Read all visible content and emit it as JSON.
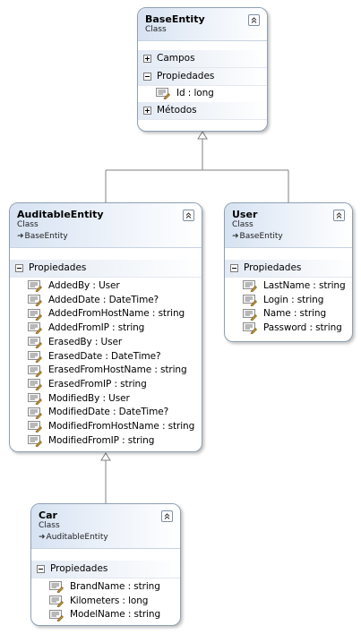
{
  "icons": {
    "collapse": "double-chevron-up-icon",
    "property": "property-icon",
    "inherits": "inheritance-arrow-icon"
  },
  "colors": {
    "border": "#8fa0b3",
    "header_grad": "#d6e2f2",
    "connector": "#808080"
  },
  "classes": {
    "base_entity": {
      "title": "BaseEntity",
      "kind": "Class",
      "sections": [
        {
          "label": "Campos",
          "state": "collapsed"
        },
        {
          "label": "Propiedades",
          "state": "expanded"
        },
        {
          "label": "Métodos",
          "state": "collapsed"
        }
      ],
      "properties": [
        "Id : long"
      ]
    },
    "auditable_entity": {
      "title": "AuditableEntity",
      "kind": "Class",
      "inherits": "BaseEntity",
      "section_label": "Propiedades",
      "properties": [
        "AddedBy : User",
        "AddedDate : DateTime?",
        "AddedFromHostName : string",
        "AddedFromIP : string",
        "ErasedBy : User",
        "ErasedDate : DateTime?",
        "ErasedFromHostName : string",
        "ErasedFromIP : string",
        "ModifiedBy : User",
        "ModifiedDate : DateTime?",
        "ModifiedFromHostName : string",
        "ModifiedFromIP : string"
      ]
    },
    "user": {
      "title": "User",
      "kind": "Class",
      "inherits": "BaseEntity",
      "section_label": "Propiedades",
      "properties": [
        "LastName : string",
        "Login : string",
        "Name : string",
        "Password : string"
      ]
    },
    "car": {
      "title": "Car",
      "kind": "Class",
      "inherits": "AuditableEntity",
      "section_label": "Propiedades",
      "properties": [
        "BrandName : string",
        "Kilometers : long",
        "ModelName : string"
      ]
    }
  }
}
